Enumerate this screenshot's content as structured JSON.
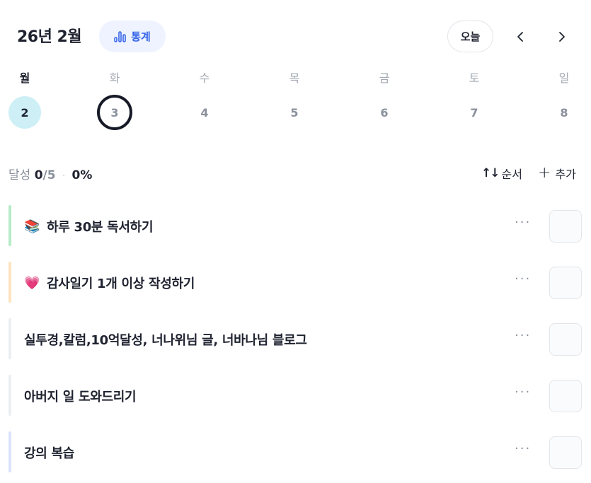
{
  "header": {
    "month_title": "26년 2월",
    "stats_label": "통계",
    "today_label": "오늘",
    "accent_color": "#3463e8"
  },
  "week": {
    "weekdays": [
      "월",
      "화",
      "수",
      "목",
      "금",
      "토",
      "일"
    ],
    "dates": [
      "2",
      "3",
      "4",
      "5",
      "6",
      "7",
      "8"
    ],
    "selected_index": 0,
    "today_index": 1
  },
  "summary": {
    "label": "달성",
    "done": "0",
    "total": "/5",
    "separator": "·",
    "percent": "0%"
  },
  "toolbar": {
    "sort_icon": "↑↓",
    "sort_label": "순서",
    "add_icon": "+",
    "add_label": "추가"
  },
  "tasks": [
    {
      "emoji": "📚",
      "title": "하루 30분 독서하기",
      "more": "···",
      "bar_color": "#b7ecc8",
      "done": false
    },
    {
      "emoji": "💗",
      "title": "감사일기 1개 이상 작성하기",
      "more": "···",
      "bar_color": "#fde3bf",
      "done": false
    },
    {
      "emoji": "",
      "title": "실투경,칼럼,10억달성, 너나위님 글, 너바나님 블로그",
      "more": "···",
      "bar_color": "#eceef1",
      "done": false
    },
    {
      "emoji": "",
      "title": "아버지 일 도와드리기",
      "more": "···",
      "bar_color": "#eceef1",
      "done": false
    },
    {
      "emoji": "",
      "title": "강의 복습",
      "more": "···",
      "bar_color": "#dbe3fb",
      "done": false
    }
  ]
}
